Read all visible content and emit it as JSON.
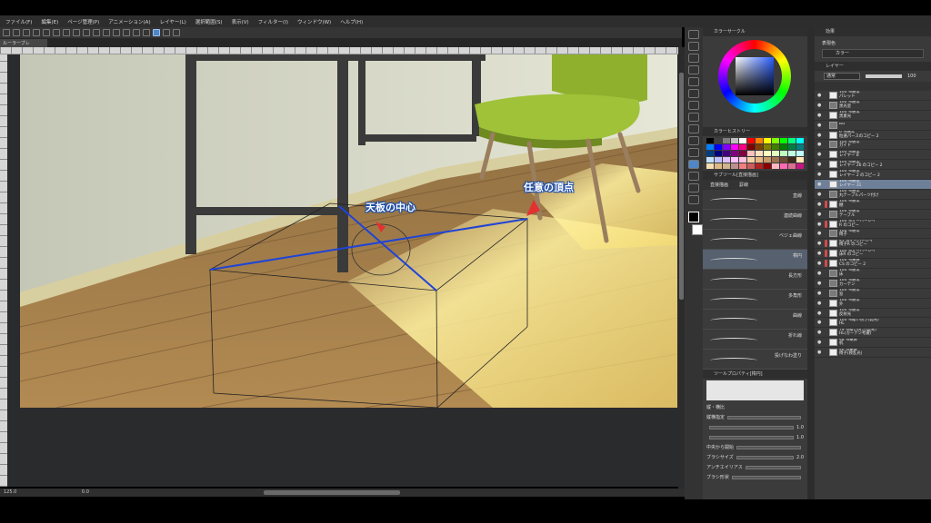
{
  "menu": [
    "ファイル(F)",
    "編集(E)",
    "ページ管理(P)",
    "アニメーション(A)",
    "レイヤー(L)",
    "選択範囲(S)",
    "表示(V)",
    "フィルター(I)",
    "ウィンドウ(W)",
    "ヘルプ(H)"
  ],
  "canvas_tab": "ルーラーブレ",
  "annotations": {
    "center": "天板の中心",
    "vertex": "任意の頂点"
  },
  "status": {
    "zoom": "125.0",
    "angle": "0.0"
  },
  "color_panel": {
    "wheel_title": "カラーサークル",
    "history_title": "カラーヒストリー"
  },
  "subtool": {
    "tab": "サブツール[直接描画]",
    "groups": [
      "直接描画",
      "罫線"
    ],
    "items": [
      "直線",
      "連続曲線",
      "ベジェ曲線",
      "楕円",
      "長方形",
      "多角形",
      "曲線",
      "折れ線",
      "投げなわ塗り"
    ],
    "selected_index": 3
  },
  "toolprop": {
    "title": "ツールプロパティ[楕円]",
    "label": "縦・横比",
    "rows": [
      {
        "label": "縦横指定",
        "value": ""
      },
      {
        "label": "",
        "value": "1.0"
      },
      {
        "label": "",
        "value": "1.0"
      },
      {
        "label": "中央から開始",
        "value": ""
      },
      {
        "label": "ブラシサイズ",
        "value": "2.0"
      },
      {
        "label": "アンチエイリアス",
        "value": ""
      },
      {
        "label": "ブラシ形状",
        "value": ""
      }
    ]
  },
  "right_panel": {
    "effect_title": "効果",
    "display_color_label": "表現色",
    "display_color_value": "カラー",
    "layer_tab": "レイヤー",
    "blend_mode": "通常",
    "opacity": "100"
  },
  "layers": [
    {
      "l1": "100 %通常",
      "l2": "パレット",
      "type": "layer",
      "mark": ""
    },
    {
      "l1": "100 %通常",
      "l2": "黒光室",
      "type": "folder",
      "mark": ""
    },
    {
      "l1": "100 %通常",
      "l2": "黒素光",
      "type": "layer",
      "mark": ""
    },
    {
      "l1": "BG",
      "l2": "",
      "type": "folder",
      "mark": ""
    },
    {
      "l1": "6 %通常",
      "l2": "粒選パースのコピー 2",
      "type": "layer",
      "mark": ""
    },
    {
      "l1": "100 %通常",
      "l2": "ガイド",
      "type": "folder",
      "mark": ""
    },
    {
      "l1": "100 %通常",
      "l2": "レイヤー 8",
      "type": "layer",
      "mark": ""
    },
    {
      "l1": "100 %通常",
      "l2": "レイヤー 26 のコピー 2",
      "type": "layer",
      "mark": ""
    },
    {
      "l1": "100 %通常",
      "l2": "レイヤー 2 のコピー 2",
      "type": "layer",
      "mark": ""
    },
    {
      "l1": "100 %通常",
      "l2": "レイヤー 31",
      "type": "layer",
      "mark": "",
      "selected": true
    },
    {
      "l1": "100 %通常",
      "l2": "丸テーブルパーツ付け",
      "type": "folder",
      "mark": ""
    },
    {
      "l1": "100 %通常",
      "l2": "棚",
      "type": "layer",
      "mark": "#d24b4b"
    },
    {
      "l1": "100 %通常",
      "l2": "テーブル",
      "type": "folder",
      "mark": ""
    },
    {
      "l1": "100 %オーバーレイ",
      "l2": "R のコピー",
      "type": "layer",
      "mark": "#d24b4b"
    },
    {
      "l1": "100 %通常",
      "l2": "椅子",
      "type": "folder",
      "mark": ""
    },
    {
      "l1": "45 %オーバーレイ",
      "l2": "椅子R のコピー",
      "type": "layer",
      "mark": "#d24b4b"
    },
    {
      "l1": "100 %オーバーレイ",
      "l2": "床R のコピー",
      "type": "layer",
      "mark": "#d24b4b"
    },
    {
      "l1": "100 %乗算",
      "l2": "CS のコピー 2",
      "type": "layer",
      "mark": "#d24b4b"
    },
    {
      "l1": "100 %通常",
      "l2": "床",
      "type": "folder",
      "mark": ""
    },
    {
      "l1": "100 %通常",
      "l2": "カーテン",
      "type": "folder",
      "mark": ""
    },
    {
      "l1": "100 %通常",
      "l2": "窓",
      "type": "folder",
      "mark": ""
    },
    {
      "l1": "100 %通常",
      "l2": "外",
      "type": "layer",
      "mark": ""
    },
    {
      "l1": "100 %通常",
      "l2": "反射光",
      "type": "layer",
      "mark": ""
    },
    {
      "l1": "100 %覆い焼き(発光)",
      "l2": "HL",
      "type": "layer",
      "mark": ""
    },
    {
      "l1": "79 %覆い焼き(発光)",
      "l2": "HL(カーテン考慮)",
      "type": "layer",
      "mark": ""
    },
    {
      "l1": "48 %乗算",
      "l2": "机",
      "type": "layer",
      "mark": ""
    },
    {
      "l1": "46 %乗算",
      "l2": "椅子(救乱光)",
      "type": "layer",
      "mark": ""
    }
  ],
  "swatches": [
    "#000000",
    "#404040",
    "#7f7f7f",
    "#bfbfbf",
    "#ffffff",
    "#ff0000",
    "#ff8000",
    "#ffff00",
    "#80ff00",
    "#00ff00",
    "#00ff80",
    "#00ffff",
    "#0080ff",
    "#0000ff",
    "#8000ff",
    "#ff00ff",
    "#ff0080",
    "#800000",
    "#804000",
    "#808000",
    "#408000",
    "#008000",
    "#008040",
    "#008080",
    "#004080",
    "#000080",
    "#400080",
    "#800080",
    "#800040",
    "#ffc0c0",
    "#ffe0c0",
    "#ffffc0",
    "#e0ffc0",
    "#c0ffc0",
    "#c0ffe0",
    "#c0ffff",
    "#c0e0ff",
    "#c0c0ff",
    "#e0c0ff",
    "#ffc0ff",
    "#ffc0e0",
    "#f4d2a8",
    "#e8b884",
    "#c99a6a",
    "#9c7350",
    "#6b4a33",
    "#3e2a1c",
    "#ffe4b5",
    "#f5deb3",
    "#deb887",
    "#d2b48c",
    "#bc8f8f",
    "#f08080",
    "#cd5c5c",
    "#b22222",
    "#8b0000",
    "#ffb6c1",
    "#ff69b4",
    "#db7093",
    "#c71585"
  ]
}
